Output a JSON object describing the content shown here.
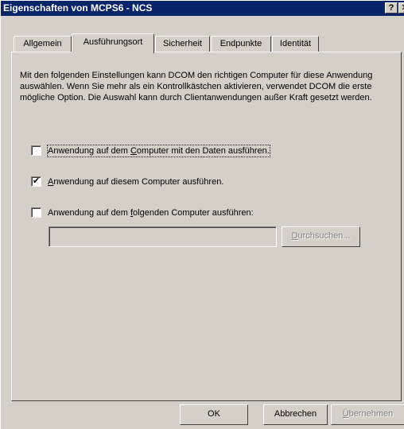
{
  "window": {
    "title": "Eigenschaften von MCPS6 - NCS",
    "help_glyph": "?",
    "close_glyph": "✕"
  },
  "tabs": [
    {
      "label": "Allgemein",
      "active": false
    },
    {
      "label": "Ausführungsort",
      "active": true
    },
    {
      "label": "Sicherheit",
      "active": false
    },
    {
      "label": "Endpunkte",
      "active": false
    },
    {
      "label": "Identität",
      "active": false
    }
  ],
  "description": "Mit den folgenden Einstellungen kann DCOM den richtigen Computer für diese Anwendung auswählen. Wenn Sie mehr als ein Kontrollkästchen aktivieren, verwendet DCOM die erste mögliche Option. Die Auswahl kann durch Clientanwendungen außer Kraft gesetzt werden.",
  "options": [
    {
      "pre": "Anwendung auf dem ",
      "mnemonic": "C",
      "post": "omputer mit den Daten ausführen.",
      "checked": false
    },
    {
      "pre": "",
      "mnemonic": "A",
      "post": "nwendung auf diesem Computer ausführen.",
      "checked": true
    },
    {
      "pre": "Anwendung auf dem ",
      "mnemonic": "f",
      "post": "olgenden Computer ausführen:",
      "checked": false
    }
  ],
  "computer_input": {
    "value": ""
  },
  "browse_button": {
    "mnemonic": "D",
    "rest": "urchsuchen..."
  },
  "footer": {
    "ok_label": "OK",
    "cancel_label": "Abbrechen",
    "apply_mnemonic": "Ü",
    "apply_rest": "bernehmen"
  }
}
